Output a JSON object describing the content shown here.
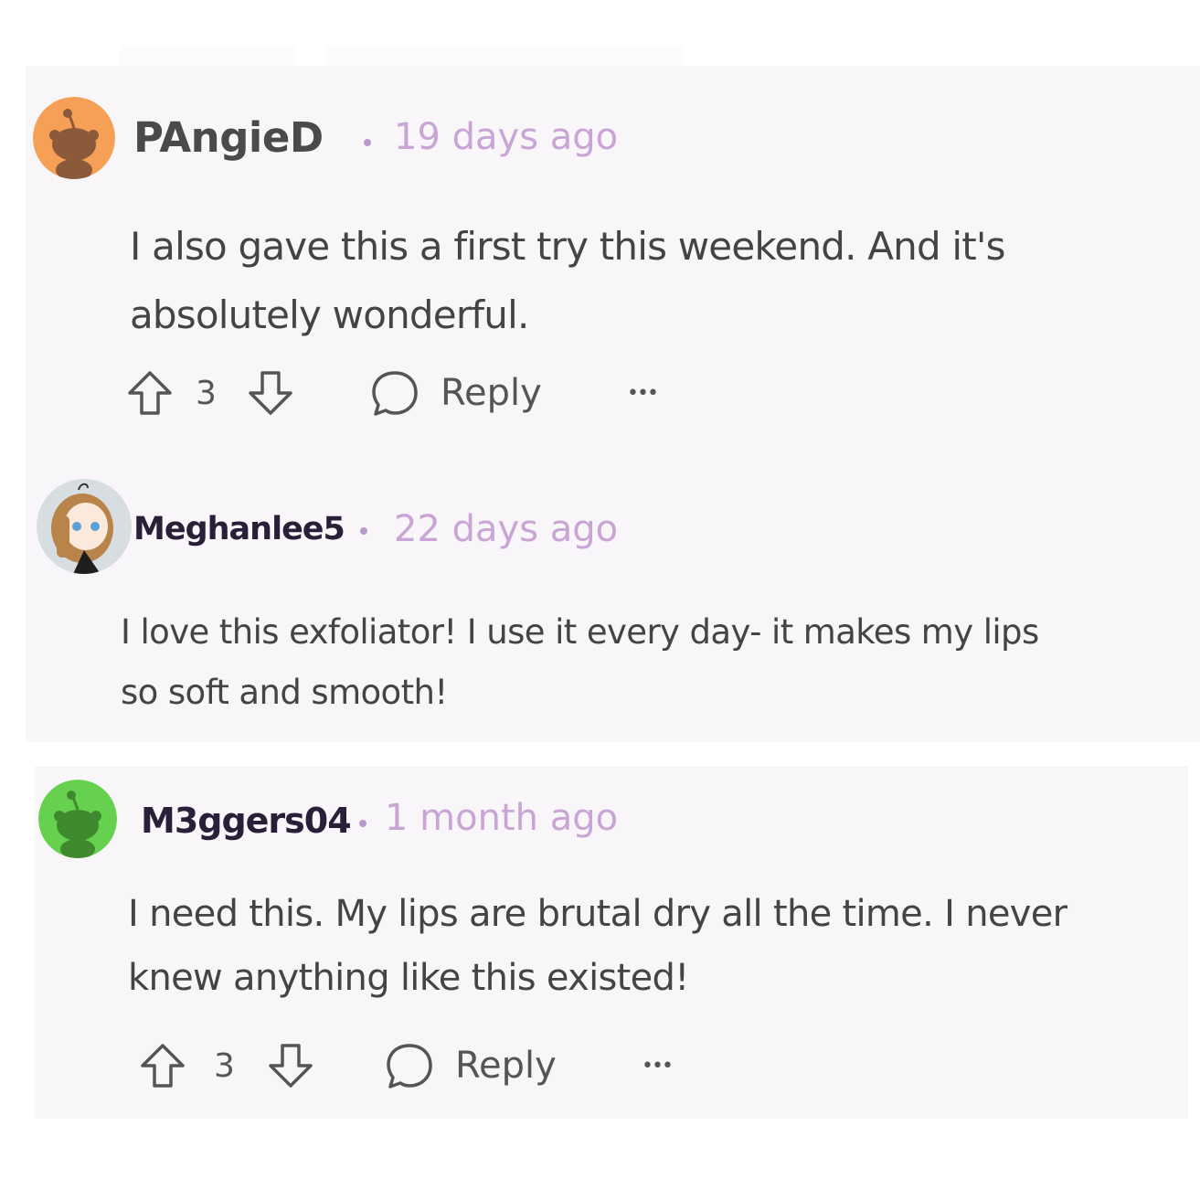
{
  "comments": [
    {
      "username": "PAngieD",
      "timestamp": "19 days ago",
      "body_lines": [
        "I also gave this a first try this weekend. And it's",
        "absolutely wonderful."
      ],
      "avatar_color": "#f5a056",
      "avatar_icon": "snoo-avatar-icon",
      "actions": {
        "upvotes": "3",
        "reply_label": "Reply",
        "more_label": "•••"
      }
    },
    {
      "username": "Meghanlee5",
      "timestamp": "22 days ago",
      "body_lines": [
        "I love this exfoliator! I use it every day- it makes my lips",
        "so soft and smooth!"
      ],
      "avatar_color": "#d8dde2",
      "avatar_icon": "anime-girl-avatar-icon"
    },
    {
      "username": "M3ggers04",
      "timestamp": "1 month ago",
      "body_lines": [
        "I need this. My lips are brutal dry all the time. I never",
        "knew anything like this existed!"
      ],
      "avatar_color": "#66d14e",
      "avatar_icon": "snoo-avatar-icon",
      "actions": {
        "upvotes": "3",
        "reply_label": "Reply",
        "more_label": "•••"
      }
    }
  ],
  "colors": {
    "card_background": "#f8f6f9",
    "timestamp": "#c9a5d6",
    "separator_dot": "#b89ac9"
  }
}
